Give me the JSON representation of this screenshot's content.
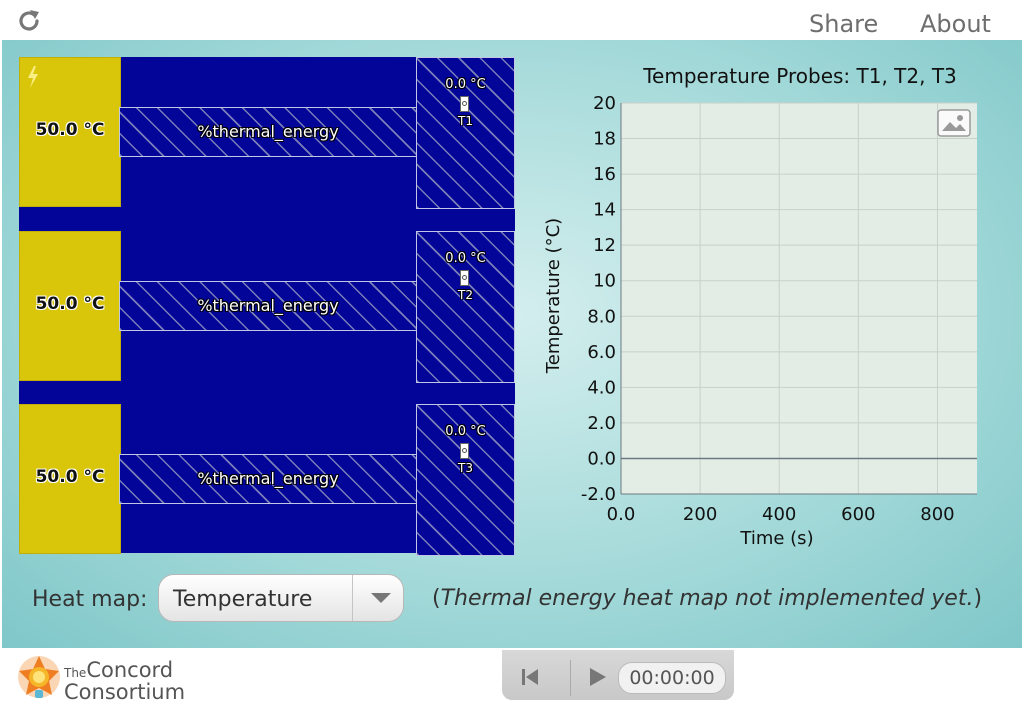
{
  "topbar": {
    "share_label": "Share",
    "about_label": "About"
  },
  "simulation": {
    "heaters": [
      {
        "temp_label": "50.0 °C"
      },
      {
        "temp_label": "50.0 °C"
      },
      {
        "temp_label": "50.0 °C"
      }
    ],
    "bars": [
      {
        "label": "%thermal_energy"
      },
      {
        "label": "%thermal_energy"
      },
      {
        "label": "%thermal_energy"
      }
    ],
    "probes": [
      {
        "value": "0.0 °C",
        "name": "T1"
      },
      {
        "value": "0.0 °C",
        "name": "T2"
      },
      {
        "value": "0.0 °C",
        "name": "T3"
      }
    ]
  },
  "graph": {
    "title": "Temperature Probes: T1, T2, T3"
  },
  "chart_data": {
    "type": "line",
    "title": "Temperature Probes: T1, T2, T3",
    "xlabel": "Time (s)",
    "ylabel": "Temperature (°C)",
    "xlim": [
      0,
      900
    ],
    "ylim": [
      -2,
      20
    ],
    "xticks": [
      0,
      200,
      400,
      600,
      800
    ],
    "xtick_labels": [
      "0.0",
      "200",
      "400",
      "600",
      "800"
    ],
    "yticks": [
      -2,
      0,
      2,
      4,
      6,
      8,
      10,
      12,
      14,
      16,
      18,
      20
    ],
    "ytick_labels": [
      "-2.0",
      "0.0",
      "2.0",
      "4.0",
      "6.0",
      "8.0",
      "10",
      "12",
      "14",
      "16",
      "18",
      "20"
    ],
    "grid": true,
    "series": [],
    "colors": {
      "plot_bg": "#e3ede5",
      "grid": "#c8d0ca",
      "axis": "#6b7a80"
    }
  },
  "controls": {
    "heatmap_label": "Heat map:",
    "heatmap_value": "Temperature",
    "note": "(Thermal energy heat map not implemented yet.)"
  },
  "footer": {
    "logo_line1_small": "The",
    "logo_line1": "Concord",
    "logo_line2": "Consortium",
    "clock": "00:00:00"
  },
  "colors": {
    "heater": "#d9c60a",
    "sim_bg": "#020598",
    "accent": "#7fc7c9"
  }
}
